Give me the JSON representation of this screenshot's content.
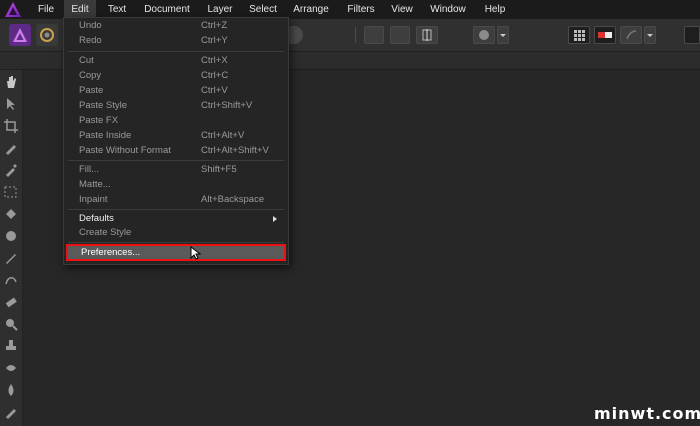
{
  "menubar": {
    "items": [
      "File",
      "Edit",
      "Text",
      "Document",
      "Layer",
      "Select",
      "Arrange",
      "Filters",
      "View",
      "Window",
      "Help"
    ],
    "active": "Edit"
  },
  "edit_menu": {
    "groups": [
      [
        {
          "label": "Undo",
          "shortcut": "Ctrl+Z"
        },
        {
          "label": "Redo",
          "shortcut": "Ctrl+Y"
        }
      ],
      [
        {
          "label": "Cut",
          "shortcut": "Ctrl+X"
        },
        {
          "label": "Copy",
          "shortcut": "Ctrl+C"
        },
        {
          "label": "Paste",
          "shortcut": "Ctrl+V"
        },
        {
          "label": "Paste Style",
          "shortcut": "Ctrl+Shift+V"
        },
        {
          "label": "Paste FX",
          "shortcut": ""
        },
        {
          "label": "Paste Inside",
          "shortcut": "Ctrl+Alt+V"
        },
        {
          "label": "Paste Without Format",
          "shortcut": "Ctrl+Alt+Shift+V"
        }
      ],
      [
        {
          "label": "Fill...",
          "shortcut": "Shift+F5"
        },
        {
          "label": "Matte...",
          "shortcut": ""
        },
        {
          "label": "Inpaint",
          "shortcut": "Alt+Backspace"
        }
      ],
      [
        {
          "label": "Defaults",
          "shortcut": "",
          "submenu": true
        },
        {
          "label": "Create Style",
          "shortcut": ""
        }
      ]
    ],
    "highlighted": {
      "label": "Preferences..."
    }
  },
  "watermark": "minwt.com",
  "colors": {
    "accent_highlight": "#e11111",
    "app_logo": "#8a2be2"
  }
}
